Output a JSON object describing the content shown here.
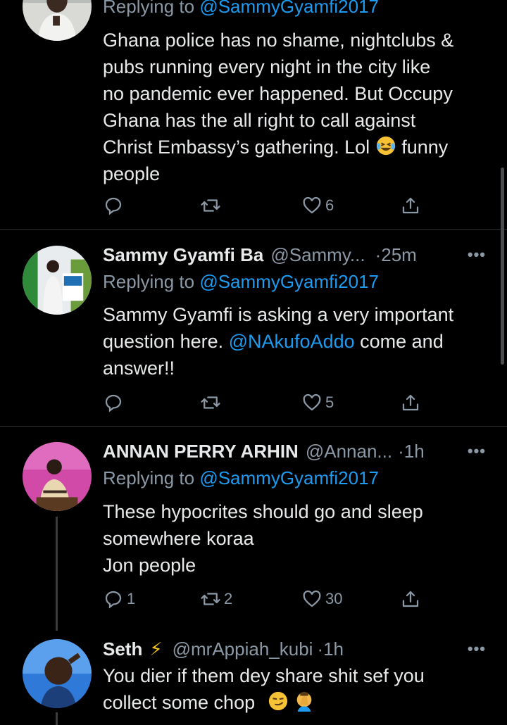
{
  "tweets": [
    {
      "replying_prefix": "Replying to ",
      "replying_handle": "@SammyGyamfi2017",
      "text_lines": [
        "Ghana police has no shame, nightclubs &",
        "pubs running every night in the city like",
        "no pandemic ever happened. But Occupy",
        "Ghana has the all right to call against",
        "Christ Embassy’s gathering. Lol"
      ],
      "text_after_emoji": "funny",
      "text_last": "people",
      "emoji": "laughing-crying-emoji",
      "reply_count": "",
      "retweet_count": "",
      "like_count": "6"
    },
    {
      "name": "Sammy Gyamfi Ba",
      "handle": "@Sammy...",
      "time": "·25m",
      "more": "•••",
      "replying_prefix": "Replying to ",
      "replying_handle": "@SammyGyamfi2017",
      "text_line1": "Sammy Gyamfi is asking a very important",
      "text_line2_before": "question here. ",
      "text_line2_mention": "@NAkufoAddo",
      "text_line2_after": " come and",
      "text_line3": "answer!!",
      "reply_count": "",
      "retweet_count": "",
      "like_count": "5"
    },
    {
      "name": "ANNAN PERRY ARHIN",
      "handle": "@Annan...",
      "time": "·1h",
      "more": "•••",
      "replying_prefix": "Replying to ",
      "replying_handle": "@SammyGyamfi2017",
      "text_lines": [
        "These hypocrites should go and sleep",
        "somewhere koraa",
        "Jon people"
      ],
      "reply_count": "1",
      "retweet_count": "2",
      "like_count": "30"
    },
    {
      "name": "Seth",
      "badge": "⚡",
      "handle": "@mrAppiah_kubi",
      "time": "·1h",
      "more": "•••",
      "text_line1": "You dier if them dey share shit sef you",
      "text_line2": "collect some chop",
      "emojis": [
        "smirking-face-emoji",
        "facepalm-emoji"
      ]
    }
  ],
  "colors": {
    "background": "#000000",
    "text": "#e7e9ea",
    "muted": "#8b98a5",
    "link": "#1d9bf0",
    "divider": "#2f3336"
  },
  "icons": [
    "reply-icon",
    "retweet-icon",
    "like-icon",
    "share-icon",
    "more-icon"
  ]
}
